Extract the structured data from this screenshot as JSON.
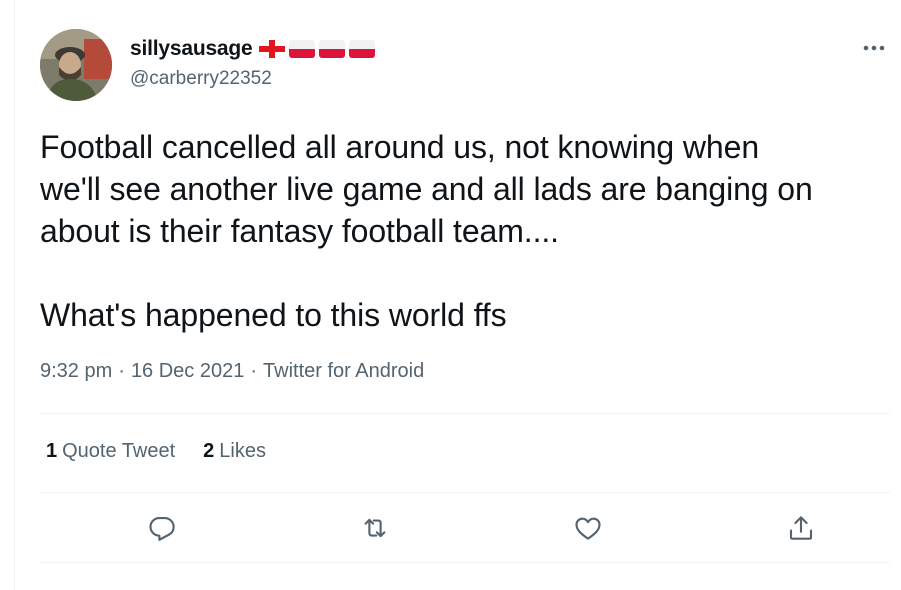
{
  "tweet": {
    "author": {
      "display_name": "sillysausage",
      "handle": "@carberry22352",
      "flags": [
        "england-flag-icon",
        "poland-flag-icon",
        "poland-flag-icon",
        "poland-flag-icon"
      ]
    },
    "text": "Football cancelled all around us, not knowing when\nwe'll see another live game and all lads are banging on\nabout is their fantasy football team....\n\nWhat's happened to this world ffs",
    "meta": {
      "time": "9:32 pm",
      "separator": "·",
      "date": "16 Dec 2021",
      "source": "Twitter for Android"
    },
    "stats": {
      "quote_count": "1",
      "quote_label": "Quote Tweet",
      "like_count": "2",
      "like_label": "Likes"
    },
    "actions": [
      "reply-icon",
      "retweet-icon",
      "like-icon",
      "share-icon"
    ]
  },
  "colors": {
    "text_primary": "#0f1419",
    "text_secondary": "#536471",
    "divider": "#eff3f4",
    "england_red": "#e4151f",
    "poland_red": "#dc143c"
  }
}
